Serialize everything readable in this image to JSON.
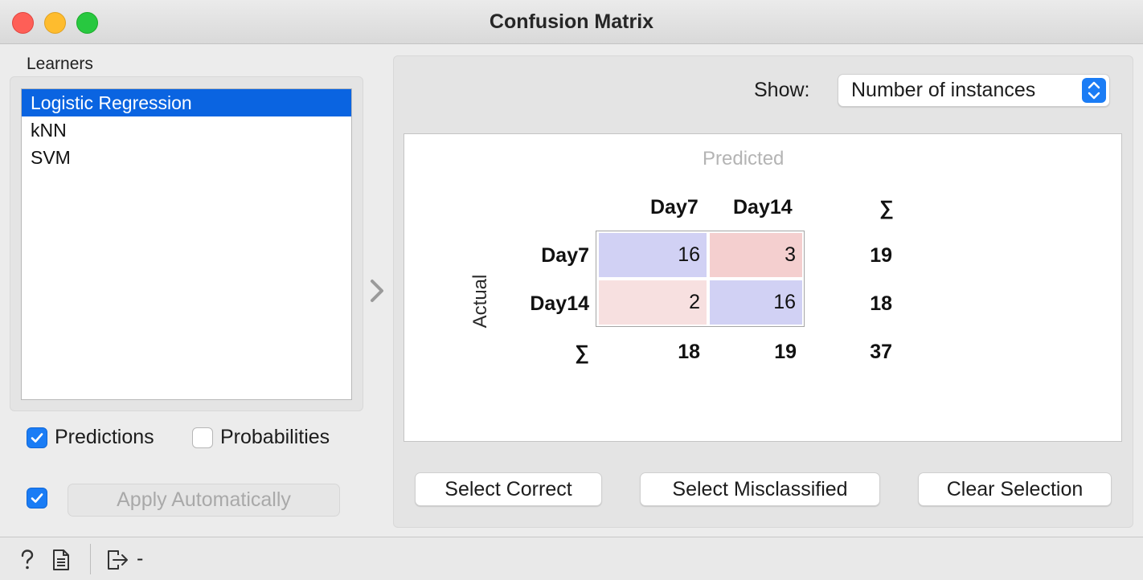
{
  "window": {
    "title": "Confusion Matrix"
  },
  "learners": {
    "label": "Learners",
    "items": [
      {
        "label": "Logistic Regression",
        "selected": true
      },
      {
        "label": "kNN",
        "selected": false
      },
      {
        "label": "SVM",
        "selected": false
      }
    ]
  },
  "options": {
    "predictions": {
      "label": "Predictions",
      "checked": true
    },
    "probabilities": {
      "label": "Probabilities",
      "checked": false
    },
    "auto_apply": {
      "checked": true,
      "button_label": "Apply Automatically",
      "enabled": false
    }
  },
  "show": {
    "label": "Show:",
    "value": "Number of instances"
  },
  "matrix": {
    "predicted_label": "Predicted",
    "actual_label": "Actual",
    "sum_symbol": "∑",
    "columns": [
      "Day7",
      "Day14"
    ],
    "rows": [
      {
        "label": "Day7",
        "cells": [
          "16",
          "3"
        ],
        "total": "19"
      },
      {
        "label": "Day14",
        "cells": [
          "2",
          "16"
        ],
        "total": "18"
      }
    ],
    "column_totals": [
      "18",
      "19"
    ],
    "grand_total": "37",
    "colors": {
      "correct": "#d1d1f4",
      "wrong_strong": "#f4cfcf",
      "wrong_light": "#f7e0e0"
    }
  },
  "buttons": {
    "select_correct": "Select Correct",
    "select_misclassified": "Select Misclassified",
    "clear_selection": "Clear Selection"
  },
  "statusbar": {
    "icons": [
      "help-icon",
      "report-icon",
      "output-icon"
    ],
    "output_text": "-"
  }
}
